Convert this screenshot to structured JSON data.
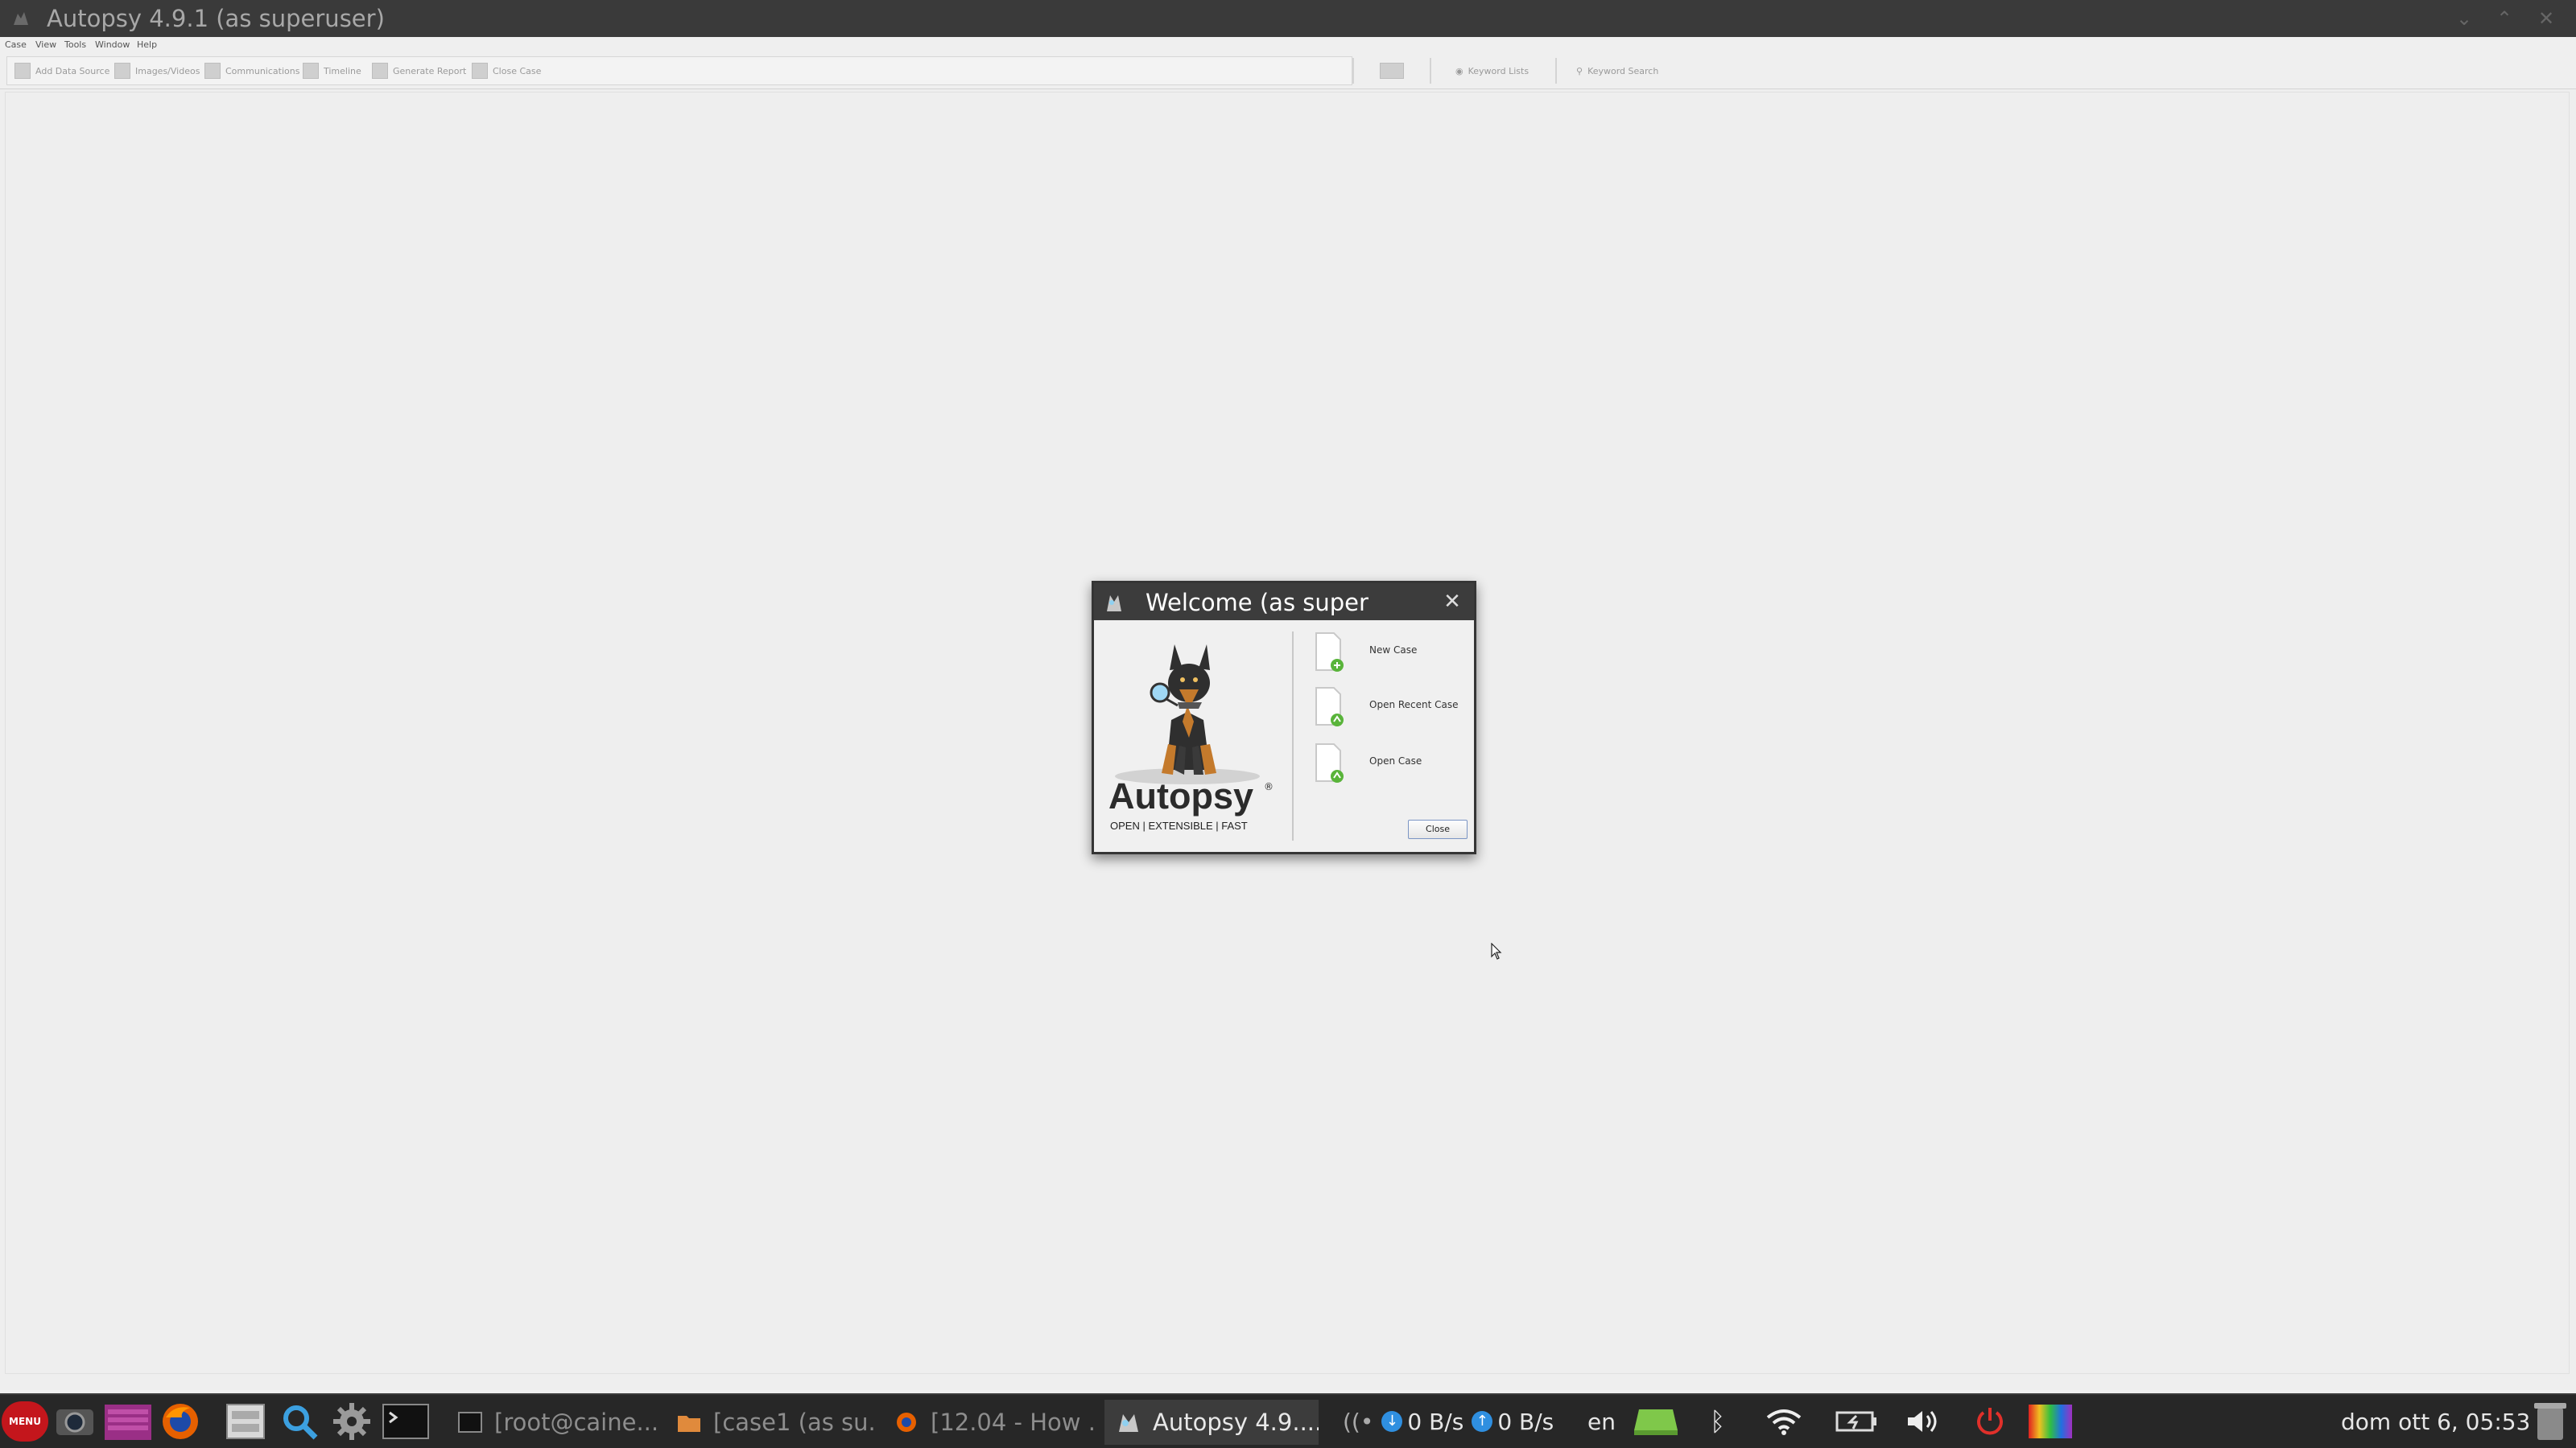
{
  "window": {
    "title": "Autopsy 4.9.1 (as superuser)",
    "controls": {
      "minimize": "⌄",
      "maximize": "⌃",
      "close": "✕"
    }
  },
  "menubar": {
    "items": [
      "Case",
      "View",
      "Tools",
      "Window",
      "Help"
    ]
  },
  "toolbar": {
    "buttons": [
      {
        "label": "Add Data Source",
        "icon": "add-data-source-icon"
      },
      {
        "label": "Images/Videos",
        "icon": "images-videos-icon"
      },
      {
        "label": "Communications",
        "icon": "communications-icon"
      },
      {
        "label": "Timeline",
        "icon": "timeline-icon"
      },
      {
        "label": "Generate Report",
        "icon": "generate-report-icon"
      },
      {
        "label": "Close Case",
        "icon": "close-case-icon"
      }
    ],
    "keyword_lists": "Keyword Lists",
    "keyword_search": "Keyword Search"
  },
  "dialog": {
    "title": "Welcome (as super",
    "close_glyph": "✕",
    "logo": {
      "word": "Autopsy",
      "registered": "®",
      "tagline": "OPEN | EXTENSIBLE | FAST"
    },
    "actions": [
      {
        "label": "New Case",
        "icon": "new-case-icon"
      },
      {
        "label": "Open Recent Case",
        "icon": "open-recent-case-icon"
      },
      {
        "label": "Open Case",
        "icon": "open-case-icon"
      }
    ],
    "close_button": "Close"
  },
  "taskbar": {
    "menu_label": "MENU",
    "tasks": [
      {
        "label": "[root@caine...",
        "icon": "terminal-icon",
        "active": false
      },
      {
        "label": "[case1 (as su...",
        "icon": "folder-icon",
        "active": false
      },
      {
        "label": "[12.04 - How ...",
        "icon": "firefox-icon",
        "active": false
      },
      {
        "label": "Autopsy 4.9....",
        "icon": "autopsy-icon",
        "active": true
      }
    ],
    "net_down": "0 B/s",
    "net_up": "0 B/s",
    "keyboard_layout": "en",
    "clock": "dom ott  6, 05:53"
  },
  "colors": {
    "titlebar": "#3a3a3a",
    "taskbar": "#272727",
    "menu_button": "#c4161c",
    "workspace": "#eeeeee"
  }
}
